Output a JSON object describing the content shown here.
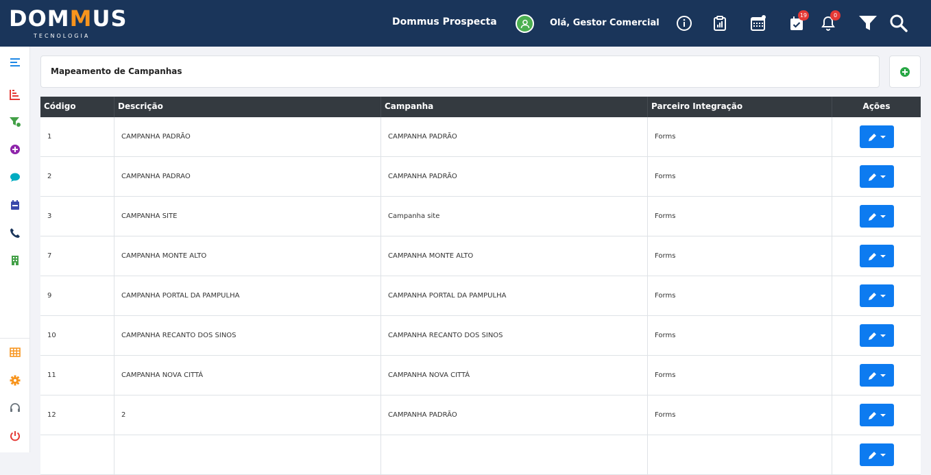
{
  "header": {
    "logo_text_pre": "DOM",
    "logo_text_accent": "M",
    "logo_text_post": "US",
    "logo_subtext": "TECNOLOGIA",
    "app_name": "Dommus Prospecta",
    "greeting": "Olá, Gestor Comercial",
    "tasks_badge": "19",
    "notifications_badge": "0"
  },
  "page": {
    "title": "Mapeamento de Campanhas"
  },
  "table": {
    "headers": [
      "Código",
      "Descrição",
      "Campanha",
      "Parceiro Integração",
      "Ações"
    ],
    "rows": [
      {
        "codigo": "1",
        "descricao": "CAMPANHA PADRÃO",
        "campanha": "CAMPANHA PADRÃO",
        "parceiro": "Forms"
      },
      {
        "codigo": "2",
        "descricao": "CAMPANHA PADRAO",
        "campanha": "CAMPANHA PADRÃO",
        "parceiro": "Forms"
      },
      {
        "codigo": "3",
        "descricao": "CAMPANHA SITE",
        "campanha": "Campanha site",
        "parceiro": "Forms"
      },
      {
        "codigo": "7",
        "descricao": "CAMPANHA MONTE ALTO",
        "campanha": "CAMPANHA MONTE ALTO",
        "parceiro": "Forms"
      },
      {
        "codigo": "9",
        "descricao": "CAMPANHA PORTAL DA PAMPULHA",
        "campanha": "CAMPANHA PORTAL DA PAMPULHA",
        "parceiro": "Forms"
      },
      {
        "codigo": "10",
        "descricao": "CAMPANHA RECANTO DOS SINOS",
        "campanha": "CAMPANHA RECANTO DOS SINOS",
        "parceiro": "Forms"
      },
      {
        "codigo": "11",
        "descricao": "CAMPANHA NOVA CITTÁ",
        "campanha": "CAMPANHA NOVA CITTÁ",
        "parceiro": "Forms"
      },
      {
        "codigo": "12",
        "descricao": "2",
        "campanha": "CAMPANHA PADRÃO",
        "parceiro": "Forms"
      },
      {
        "codigo": "",
        "descricao": "",
        "campanha": "",
        "parceiro": ""
      }
    ]
  },
  "icons": {
    "topbar": [
      "info-icon",
      "report-icon",
      "calendar-icon",
      "tasks-icon",
      "bell-icon",
      "filter-icon",
      "search-icon"
    ],
    "sidebar": [
      "menu-icon",
      "bar-chart-icon",
      "funnel-icon",
      "add-circle-icon",
      "chat-icon",
      "calendar-icon",
      "phone-icon",
      "building-icon",
      "grid-icon",
      "gear-icon",
      "headset-icon",
      "power-icon"
    ]
  },
  "colors": {
    "topbar_bg": "#1a355a",
    "logo_accent": "#f7941d",
    "edit_button": "#0d7bf0",
    "table_header": "#343a40",
    "badge": "#e53935"
  }
}
